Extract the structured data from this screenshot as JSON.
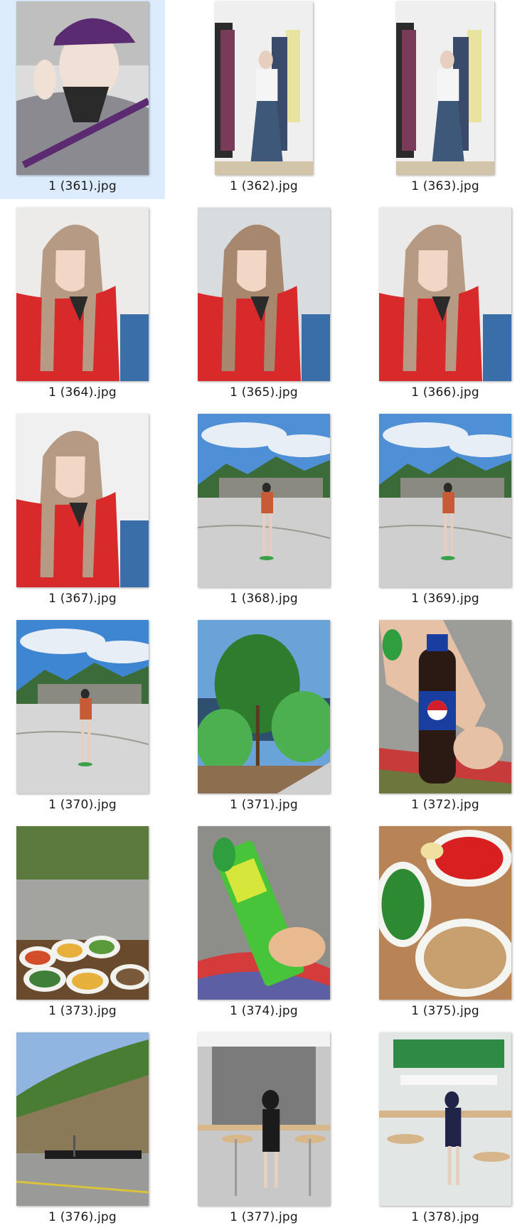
{
  "selected_index": 0,
  "files": [
    {
      "name": "1 (361).jpg",
      "kind": "selfie-cap",
      "colors": [
        "#dcdcdc",
        "#8a8a90",
        "#5a2b70",
        "#f0e0d6",
        "#2a2a2a"
      ]
    },
    {
      "name": "1 (362).jpg",
      "kind": "store-mirror",
      "colors": [
        "#efefef",
        "#c9c9c9",
        "#3d5878",
        "#2b2b2b",
        "#e8e4a0"
      ]
    },
    {
      "name": "1 (363).jpg",
      "kind": "store-mirror",
      "colors": [
        "#efefef",
        "#c9c9c9",
        "#3d5878",
        "#2b2b2b",
        "#e8e4a0"
      ]
    },
    {
      "name": "1 (364).jpg",
      "kind": "portrait-red",
      "colors": [
        "#ecebea",
        "#b69a83",
        "#d82a2a",
        "#f2d6c6",
        "#3a6ea8"
      ]
    },
    {
      "name": "1 (365).jpg",
      "kind": "portrait-red",
      "colors": [
        "#d8dcdf",
        "#a8876f",
        "#d82a2a",
        "#f2d6c6",
        "#3a6ea8"
      ]
    },
    {
      "name": "1 (366).jpg",
      "kind": "portrait-red",
      "colors": [
        "#eaeaea",
        "#b69a83",
        "#d82a2a",
        "#f2d6c6",
        "#3a6ea8"
      ]
    },
    {
      "name": "1 (367).jpg",
      "kind": "portrait-red",
      "colors": [
        "#f0f0f0",
        "#b69a83",
        "#d82a2a",
        "#f2d6c6",
        "#3a6ea8"
      ]
    },
    {
      "name": "1 (368).jpg",
      "kind": "landscape-girl",
      "colors": [
        "#4f8fd6",
        "#e8eef5",
        "#3c6b3a",
        "#cfcfcf",
        "#c65b35"
      ]
    },
    {
      "name": "1 (369).jpg",
      "kind": "landscape-girl",
      "colors": [
        "#4f8fd6",
        "#e8eef5",
        "#3c6b3a",
        "#cfcfcf",
        "#c65b35"
      ]
    },
    {
      "name": "1 (370).jpg",
      "kind": "landscape-girl",
      "colors": [
        "#3f86d2",
        "#e8eef5",
        "#3c6b3a",
        "#d6d6d6",
        "#c65b35"
      ]
    },
    {
      "name": "1 (371).jpg",
      "kind": "plants",
      "colors": [
        "#6aa3d8",
        "#2e7d2e",
        "#4caf50",
        "#8d6e4f",
        "#d0d0d0"
      ]
    },
    {
      "name": "1 (372).jpg",
      "kind": "pepsi",
      "colors": [
        "#9c9c98",
        "#e7c1a6",
        "#1a3ea0",
        "#d11f2b",
        "#2f9e3f"
      ]
    },
    {
      "name": "1 (373).jpg",
      "kind": "food-road",
      "colors": [
        "#5d7a3e",
        "#a3a3a0",
        "#e6b03a",
        "#d24e2a",
        "#f2f2ee"
      ]
    },
    {
      "name": "1 (374).jpg",
      "kind": "icecream",
      "colors": [
        "#8d8d89",
        "#48c43a",
        "#e9b98f",
        "#d43b3b",
        "#2a6fd1"
      ]
    },
    {
      "name": "1 (375).jpg",
      "kind": "dishes",
      "colors": [
        "#b88355",
        "#f4f4f1",
        "#2d8a32",
        "#d82020",
        "#c8a070"
      ]
    },
    {
      "name": "1 (376).jpg",
      "kind": "hill-goats",
      "colors": [
        "#8fb5e0",
        "#4a7d34",
        "#8a7a58",
        "#1d1d1d",
        "#d8c33a"
      ]
    },
    {
      "name": "1 (377).jpg",
      "kind": "cafe",
      "colors": [
        "#c8c8c8",
        "#5a5a5a",
        "#1b1b1b",
        "#d8b889",
        "#f2f2f2"
      ]
    },
    {
      "name": "1 (378).jpg",
      "kind": "cafe-blue",
      "colors": [
        "#e2e6e4",
        "#2f8a45",
        "#202448",
        "#d7b58a",
        "#f7f7f7"
      ]
    }
  ]
}
